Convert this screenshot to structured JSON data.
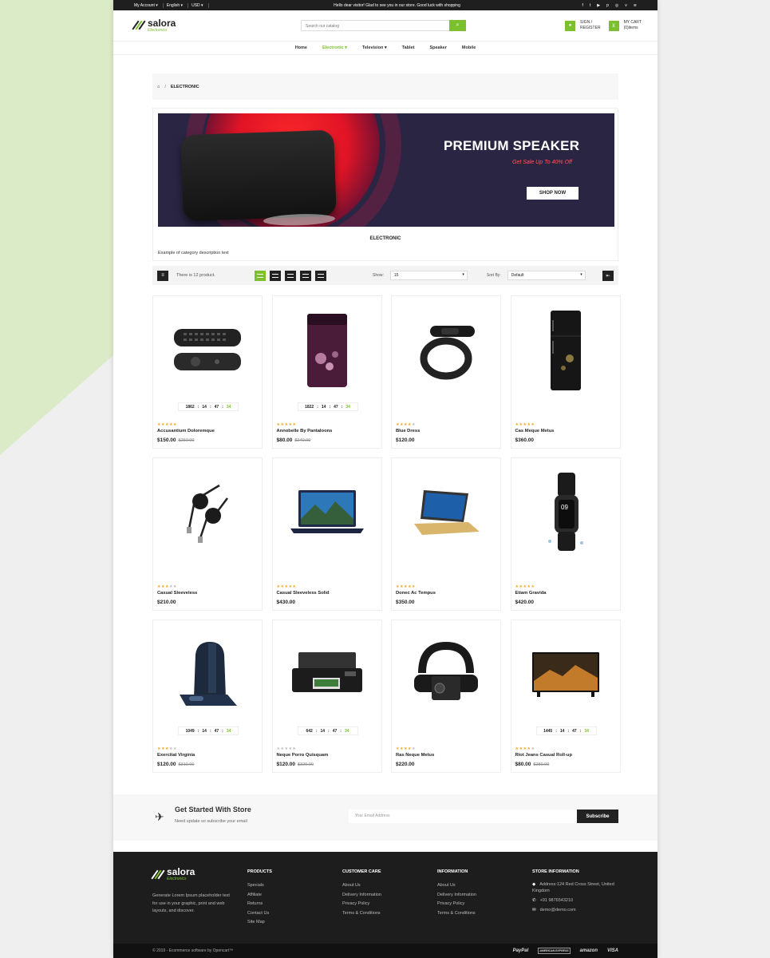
{
  "topbar": {
    "account": "My Account",
    "language": "English",
    "currency": "USD",
    "welcome": "Hello dear visitor! Glad to see you in our store. Good luck with shopping",
    "social": [
      "f",
      "t",
      "▶",
      "p",
      "◎",
      "v",
      "≋"
    ]
  },
  "header": {
    "logo_name": "salora",
    "logo_sub": "Electronics",
    "search_placeholder": "Search our catalog",
    "signin_line1": "SIGN /",
    "signin_line2": "REGISTER",
    "cart_line1": "MY CART",
    "cart_line2": "(0)items"
  },
  "nav": [
    "Home",
    "Electronic",
    "Television",
    "Tablet",
    "Speaker",
    "Mobile"
  ],
  "breadcrumb": {
    "current": "ELECTRONIC"
  },
  "banner": {
    "title": "PREMIUM SPEAKER",
    "subtitle": "Get Sale Up To 40%  Off",
    "cta": "SHOP NOW"
  },
  "category": {
    "title": "ELECTRONIC",
    "description": "Example of category description text"
  },
  "toolbar": {
    "count": "There is 12 product.",
    "show_label": "Show:",
    "show_value": "15",
    "sort_label": "Sort By:",
    "sort_value": "Default"
  },
  "products": [
    {
      "name": "Accusantium Doloremque",
      "price": "$150.00",
      "old": "$250.00",
      "rating": 5,
      "timer": [
        "1862",
        "14",
        "47",
        "34"
      ]
    },
    {
      "name": "Annobelle By Pantaloons",
      "price": "$80.00",
      "old": "$240.00",
      "rating": 5,
      "timer": [
        "1822",
        "14",
        "47",
        "34"
      ]
    },
    {
      "name": "Blue Dress",
      "price": "$120.00",
      "old": "",
      "rating": 4,
      "timer": null
    },
    {
      "name": "Cas Meque Metus",
      "price": "$360.00",
      "old": "",
      "rating": 5,
      "timer": null
    },
    {
      "name": "Casual Sleeveless",
      "price": "$210.00",
      "old": "",
      "rating": 3,
      "timer": null
    },
    {
      "name": "Casual Sleeveless Solid",
      "price": "$430.00",
      "old": "",
      "rating": 5,
      "timer": null
    },
    {
      "name": "Donec Ac Tempus",
      "price": "$350.00",
      "old": "",
      "rating": 5,
      "timer": null
    },
    {
      "name": "Etiam Gravida",
      "price": "$420.00",
      "old": "",
      "rating": 5,
      "timer": null
    },
    {
      "name": "Exercitat Virginia",
      "price": "$120.00",
      "old": "$310.00",
      "rating": 3,
      "timer": [
        "1049",
        "14",
        "47",
        "34"
      ]
    },
    {
      "name": "Neque Porro Quisquam",
      "price": "$120.00",
      "old": "$320.00",
      "rating": 0,
      "timer": [
        "642",
        "14",
        "47",
        "34"
      ]
    },
    {
      "name": "Ras Neque Metus",
      "price": "$220.00",
      "old": "",
      "rating": 4,
      "timer": null
    },
    {
      "name": "Riot Jeans Casual Roll-up",
      "price": "$80.00",
      "old": "$280.00",
      "rating": 4,
      "timer": [
        "1445",
        "14",
        "47",
        "34"
      ]
    }
  ],
  "newsletter": {
    "title": "Get Started With Store",
    "subtitle": "Need update so subscribe your email",
    "placeholder": "Your Email Address",
    "button": "Subscribe"
  },
  "footer": {
    "logo_name": "salora",
    "logo_sub": "Electronics",
    "description": "Generate Lorem Ipsum placeholder text for use in your graphic, print and web layouts, and discover.",
    "products_title": "PRODUCTS",
    "products": [
      "Specials",
      "Affiliate",
      "Returns",
      "Contact Us",
      "Site Map"
    ],
    "care_title": "CUSTOMER CARE",
    "care": [
      "About Us",
      "Delivery Information",
      "Privacy Policy",
      "Terms & Conditions"
    ],
    "info_title": "INFORMATION",
    "info": [
      "About Us",
      "Delivery Information",
      "Privacy Policy",
      "Terms & Conditions"
    ],
    "store_title": "STORE INFORMATION",
    "address": "Address:124 Red Cross Street, United Kingdom",
    "phone": "+91 9876543210",
    "email": "demo@demo.com",
    "copyright": "© 2019 - Ecommerce software by Opencart™",
    "payments": [
      "PayPal",
      "AMERICAN EXPRESS",
      "amazon",
      "VISA"
    ]
  },
  "colors": {
    "accent": "#7cc02e",
    "dark": "#1f1f1f",
    "star": "#f5a623"
  }
}
